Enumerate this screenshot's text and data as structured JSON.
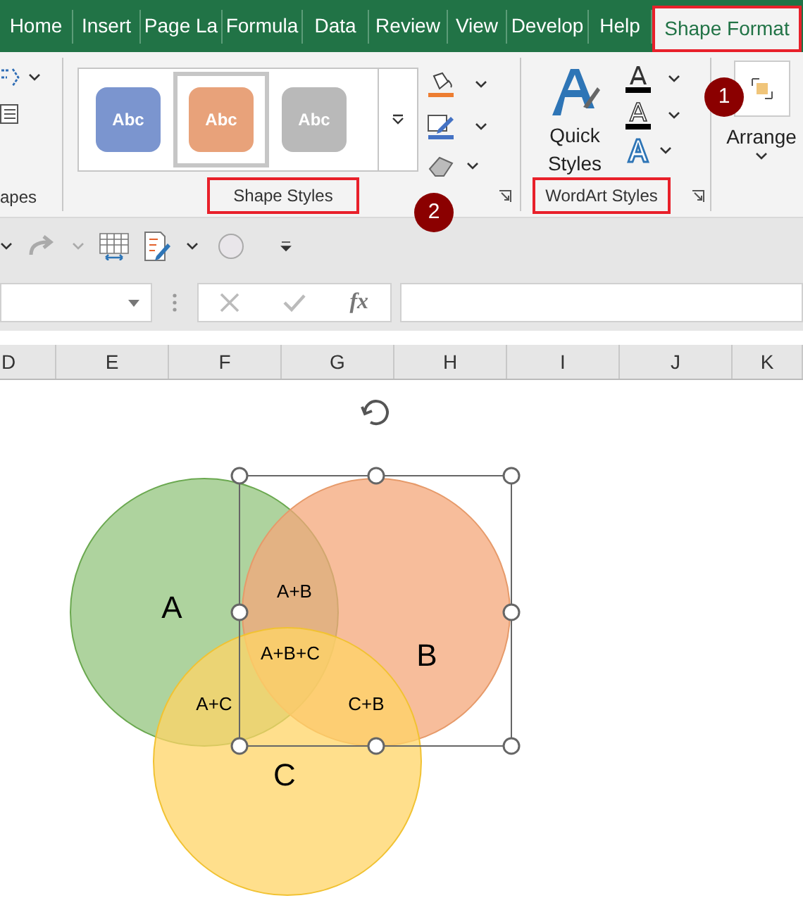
{
  "tabs": [
    {
      "label": "Home",
      "selected": false
    },
    {
      "label": "Insert",
      "selected": false
    },
    {
      "label": "Page La",
      "selected": false
    },
    {
      "label": "Formula",
      "selected": false
    },
    {
      "label": "Data",
      "selected": false
    },
    {
      "label": "Review",
      "selected": false
    },
    {
      "label": "View",
      "selected": false
    },
    {
      "label": "Develop",
      "selected": false
    },
    {
      "label": "Help",
      "selected": false
    },
    {
      "label": "Shape Format",
      "selected": true
    }
  ],
  "ribbon": {
    "left_group_label": "apes",
    "shape_styles": {
      "thumbnails": [
        {
          "label": "Abc",
          "color": "#7b95cf",
          "selected": false
        },
        {
          "label": "Abc",
          "color": "#e8a27a",
          "selected": true
        },
        {
          "label": "Abc",
          "color": "#b9b9b9",
          "selected": false
        }
      ],
      "label": "Shape Styles"
    },
    "wordart_styles": {
      "quick_styles": "Quick Styles",
      "label": "WordArt Styles"
    },
    "arrange": {
      "label": "Arrange"
    }
  },
  "callouts": [
    {
      "number": "1"
    },
    {
      "number": "2"
    }
  ],
  "formula_bar": {
    "fx": "fx"
  },
  "columns": [
    "D",
    "E",
    "F",
    "G",
    "H",
    "I",
    "J",
    "K"
  ],
  "venn": {
    "circles": [
      {
        "label": "A",
        "color": "#93c47d"
      },
      {
        "label": "B",
        "color": "#f4a77a"
      },
      {
        "label": "C",
        "color": "#ffd466"
      }
    ],
    "overlaps": [
      "A+B",
      "A+B+C",
      "A+C",
      "C+B"
    ]
  }
}
